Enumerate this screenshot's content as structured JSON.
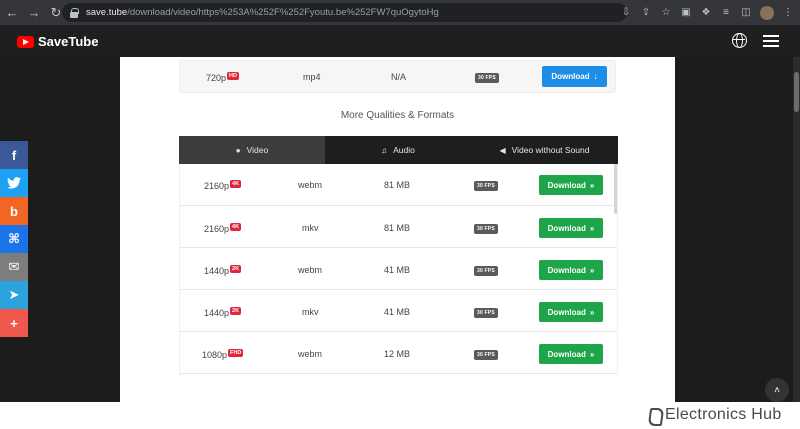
{
  "browser": {
    "url_host": "save.tube",
    "url_path": "/download/video/https%253A%252F%252Fyoutu.be%252FW7quOgytoHg",
    "nav_back": "←",
    "nav_forward": "→",
    "nav_reload": "↻",
    "ext_icons": [
      "⇩",
      "⇪",
      "☆",
      "▣",
      "❖",
      "≡",
      "◫",
      "⋮"
    ]
  },
  "site": {
    "logo_text": "SaveTube"
  },
  "top_row": {
    "quality": "720p",
    "badge": "HD",
    "format": "mp4",
    "size": "N/A",
    "fps": "30 FPS",
    "download_label": "Download",
    "download_arrow": "↓"
  },
  "more_title": "More Qualities & Formats",
  "tabs": [
    {
      "label": "Video",
      "icon": "●"
    },
    {
      "label": "Audio",
      "icon": "♫"
    },
    {
      "label": "Video without Sound",
      "icon": "◀"
    }
  ],
  "rows": [
    {
      "quality": "2160p",
      "badge": "4K",
      "format": "webm",
      "size": "81 MB",
      "fps": "30 FPS",
      "download_label": "Download",
      "arrow": "»"
    },
    {
      "quality": "2160p",
      "badge": "4K",
      "format": "mkv",
      "size": "81 MB",
      "fps": "30 FPS",
      "download_label": "Download",
      "arrow": "»"
    },
    {
      "quality": "1440p",
      "badge": "2K",
      "format": "webm",
      "size": "41 MB",
      "fps": "30 FPS",
      "download_label": "Download",
      "arrow": "»"
    },
    {
      "quality": "1440p",
      "badge": "2K",
      "format": "mkv",
      "size": "41 MB",
      "fps": "30 FPS",
      "download_label": "Download",
      "arrow": "»"
    },
    {
      "quality": "1080p",
      "badge": "FHD",
      "format": "webm",
      "size": "12 MB",
      "fps": "30 FPS",
      "download_label": "Download",
      "arrow": "»"
    }
  ],
  "social": [
    {
      "icon": "f",
      "color": "#3b5998",
      "name": "facebook"
    },
    {
      "icon": "✉",
      "color": "#1da1f2",
      "name": "twitter"
    },
    {
      "icon": "b",
      "color": "#f26522",
      "name": "blogger"
    },
    {
      "icon": "⌘",
      "color": "#1a73e8",
      "name": "copy-link"
    },
    {
      "icon": "✉",
      "color": "#7d7d7d",
      "name": "email"
    },
    {
      "icon": "➤",
      "color": "#2aa3df",
      "name": "telegram"
    },
    {
      "icon": "+",
      "color": "#f0574d",
      "name": "more"
    }
  ],
  "scroll_top_icon": "˄",
  "watermark": {
    "text": "Electronics Hub"
  }
}
